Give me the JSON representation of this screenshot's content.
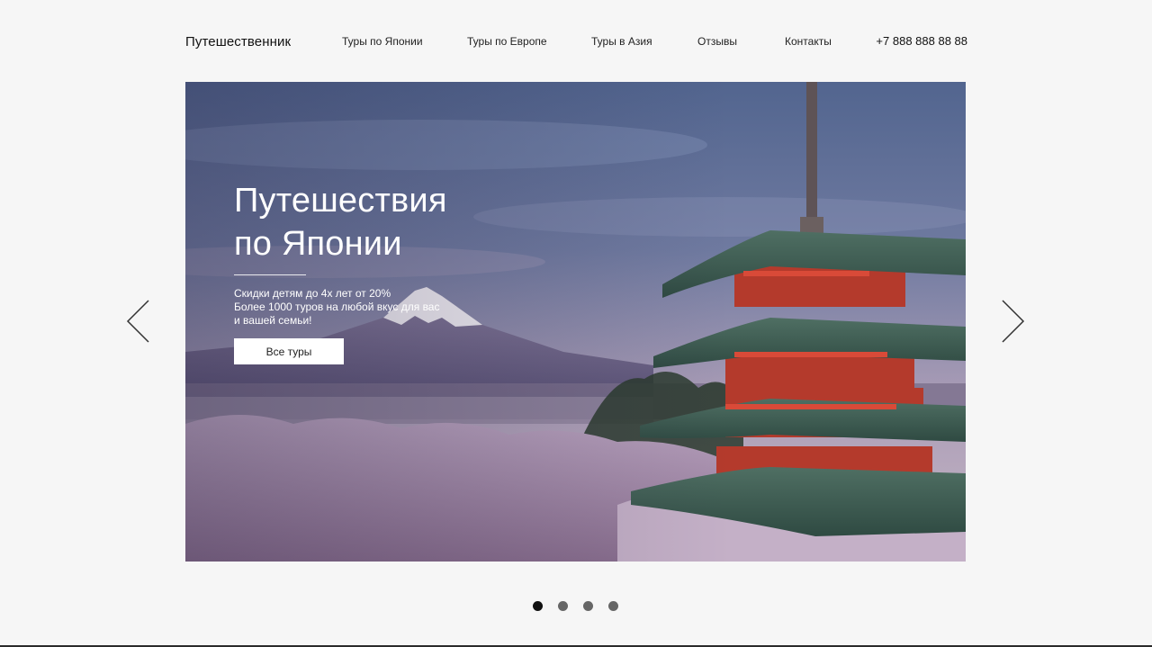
{
  "header": {
    "logo": "Путешественник",
    "nav": [
      {
        "label": "Туры по Японии"
      },
      {
        "label": "Туры по Европе"
      },
      {
        "label": "Туры в Азия"
      },
      {
        "label": "Отзывы"
      },
      {
        "label": "Контакты"
      }
    ],
    "phone": "+7 888 888 88 88"
  },
  "hero": {
    "title_line1": "Путешествия",
    "title_line2": "по Японии",
    "text_line1": "Скидки детям до 4х лет от 20%",
    "text_line2": "Более 1000 туров на любой вкус для вас",
    "text_line3": "и вашей семьи!",
    "button_label": "Все туры"
  },
  "slider": {
    "prev_icon": "chevron-left-icon",
    "next_icon": "chevron-right-icon",
    "slide_count": 4,
    "active_slide": 1
  },
  "colors": {
    "page_bg": "#f6f6f6",
    "text": "#111111",
    "dot_active": "#111111",
    "dot_inactive": "#666666"
  }
}
